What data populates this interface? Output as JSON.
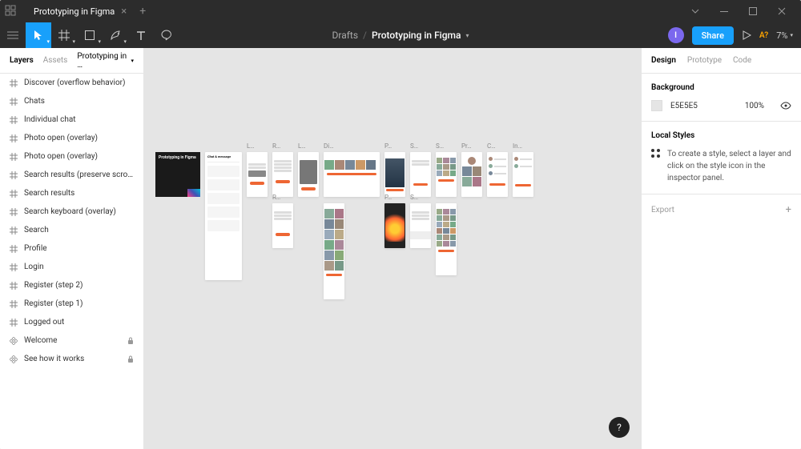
{
  "titlebar": {
    "tab_name": "Prototyping in Figma"
  },
  "toolbar": {
    "breadcrumb_folder": "Drafts",
    "breadcrumb_file": "Prototyping in Figma",
    "avatar_initial": "I",
    "share_label": "Share",
    "missing_fonts": "A?",
    "zoom": "7%"
  },
  "left_panel": {
    "tabs": {
      "layers": "Layers",
      "assets": "Assets"
    },
    "page": "Prototyping in …",
    "layers": [
      {
        "name": "Discover (overflow behavior)",
        "type": "frame"
      },
      {
        "name": "Chats",
        "type": "frame"
      },
      {
        "name": "Individual chat",
        "type": "frame"
      },
      {
        "name": "Photo open (overlay)",
        "type": "frame"
      },
      {
        "name": "Photo open (overlay)",
        "type": "frame"
      },
      {
        "name": "Search results (preserve scroll po…",
        "type": "frame"
      },
      {
        "name": "Search results",
        "type": "frame"
      },
      {
        "name": "Search keyboard (overlay)",
        "type": "frame"
      },
      {
        "name": "Search",
        "type": "frame"
      },
      {
        "name": "Profile",
        "type": "frame"
      },
      {
        "name": "Login",
        "type": "frame"
      },
      {
        "name": "Register (step 2)",
        "type": "frame"
      },
      {
        "name": "Register (step 1)",
        "type": "frame"
      },
      {
        "name": "Logged out",
        "type": "frame"
      },
      {
        "name": "Welcome",
        "type": "component",
        "locked": true
      },
      {
        "name": "See how it works",
        "type": "component",
        "locked": true
      }
    ]
  },
  "canvas": {
    "cover_text": "Prototyping in Figma",
    "frame_labels": [
      "L…",
      "R…",
      "L…",
      "Di…",
      "P…",
      "S…",
      "S…",
      "Pr…",
      "C…",
      "In…",
      "R…",
      "P…",
      "S…"
    ]
  },
  "right_panel": {
    "tabs": {
      "design": "Design",
      "prototype": "Prototype",
      "code": "Code"
    },
    "background": {
      "title": "Background",
      "hex": "E5E5E5",
      "opacity": "100%"
    },
    "local_styles": {
      "title": "Local Styles",
      "hint": "To create a style, select a layer and click on the style icon in the inspector panel."
    },
    "export": "Export"
  }
}
